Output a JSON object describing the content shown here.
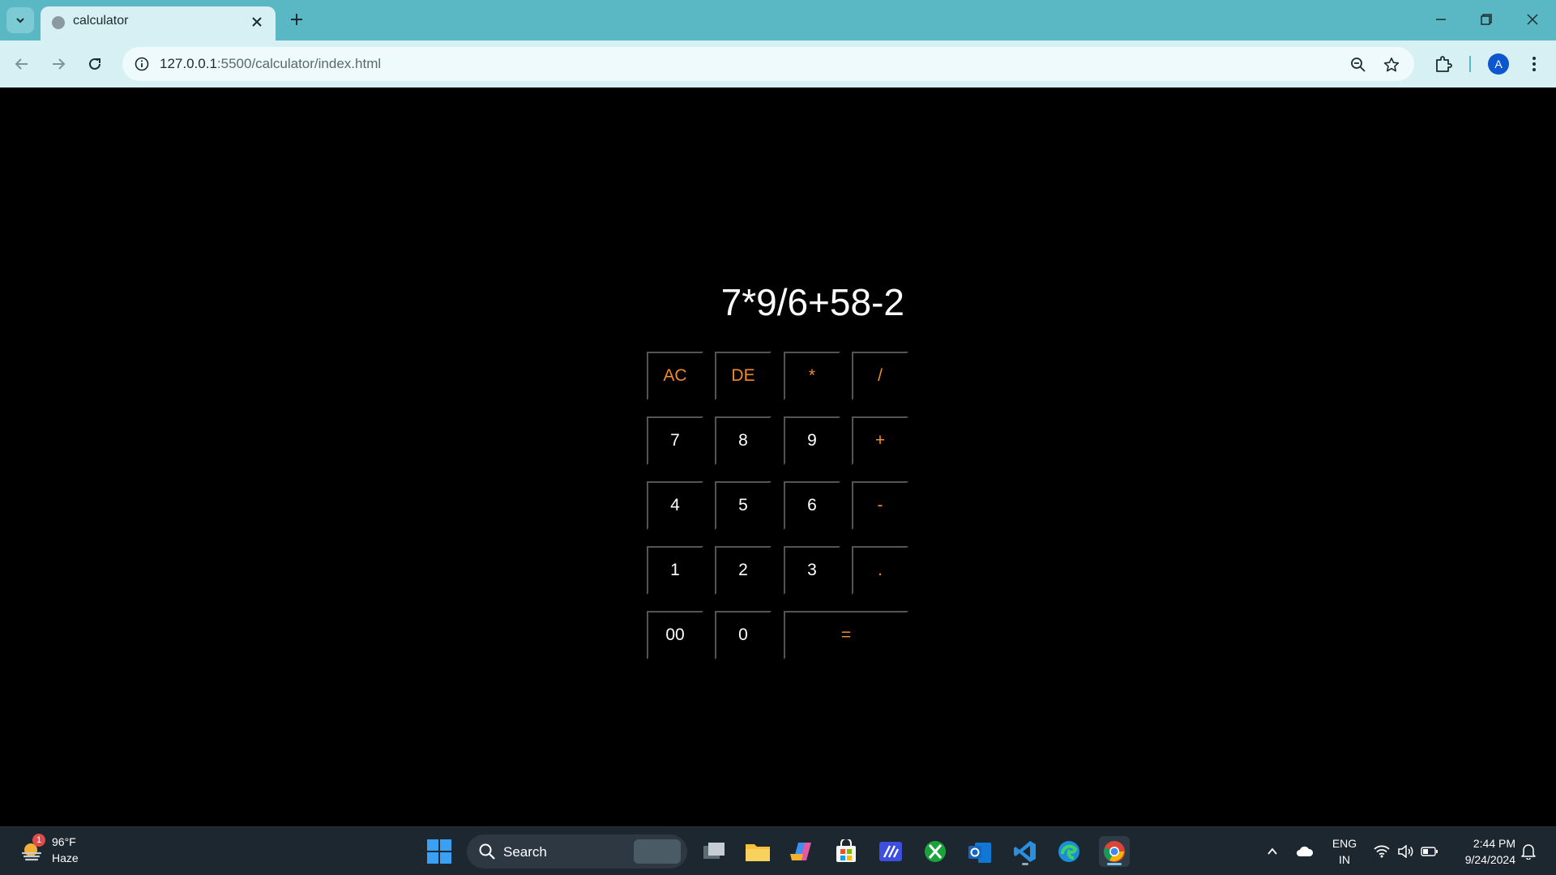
{
  "browser": {
    "tab_title": "calculator",
    "url_host": "127.0.0.1",
    "url_rest": ":5500/calculator/index.html",
    "profile_initial": "A"
  },
  "calculator": {
    "display": "7*9/6+58-2",
    "keys": {
      "ac": "AC",
      "de": "DE",
      "mul": "*",
      "div": "/",
      "k7": "7",
      "k8": "8",
      "k9": "9",
      "add": "+",
      "k4": "4",
      "k5": "5",
      "k6": "6",
      "sub": "-",
      "k1": "1",
      "k2": "2",
      "k3": "3",
      "dot": ".",
      "k00": "00",
      "k0": "0",
      "eq": "="
    },
    "colors": {
      "operator": "#f08a28",
      "digit": "#ffffff",
      "background": "#000000"
    }
  },
  "taskbar": {
    "weather_temp": "96°F",
    "weather_cond": "Haze",
    "weather_badge": "1",
    "search_label": "Search",
    "lang_line1": "ENG",
    "lang_line2": "IN",
    "time": "2:44 PM",
    "date": "9/24/2024"
  }
}
